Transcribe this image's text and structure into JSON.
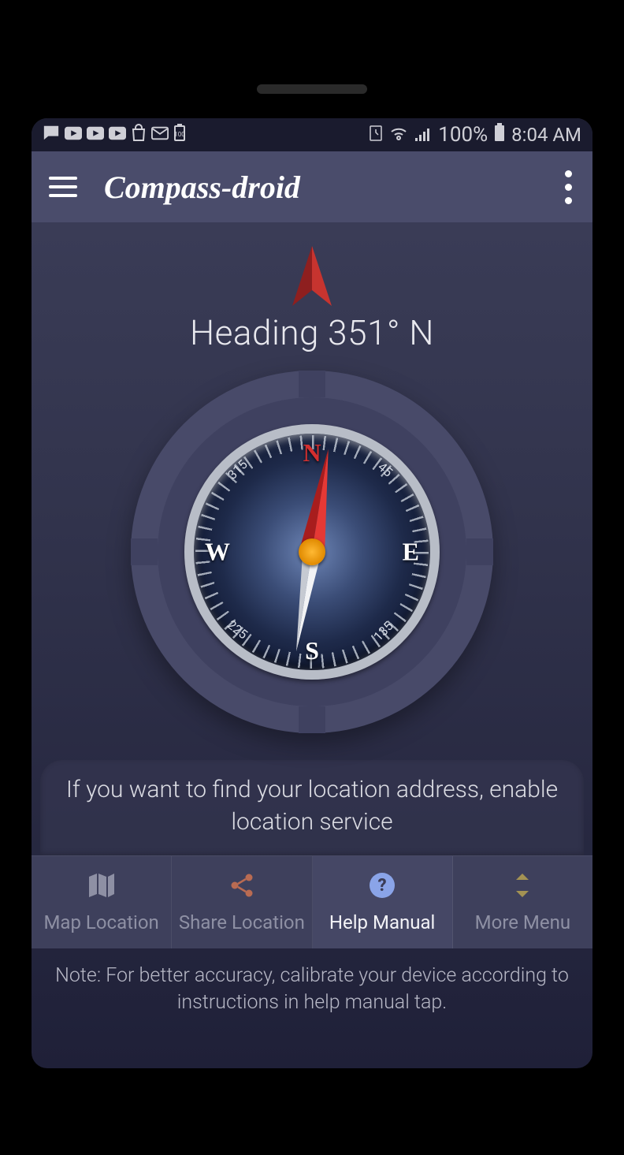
{
  "statusbar": {
    "battery_text": "100%",
    "time": "8:04 AM"
  },
  "appbar": {
    "title": "Compass-droid"
  },
  "main": {
    "heading_text": "Heading 351° N",
    "dir_n": "N",
    "dir_s": "S",
    "dir_e": "E",
    "dir_w": "W",
    "deg_45": "45",
    "deg_135": "135",
    "deg_225": "225",
    "deg_315": "315",
    "info_message": "If you want to find your location address, enable location service"
  },
  "nav": {
    "items": [
      {
        "label": "Map Location"
      },
      {
        "label": "Share Location"
      },
      {
        "label": "Help Manual"
      },
      {
        "label": "More Menu"
      }
    ],
    "active_index": 2
  },
  "footer": {
    "note": "Note: For better accuracy, calibrate your device according to instructions in help manual tap."
  }
}
